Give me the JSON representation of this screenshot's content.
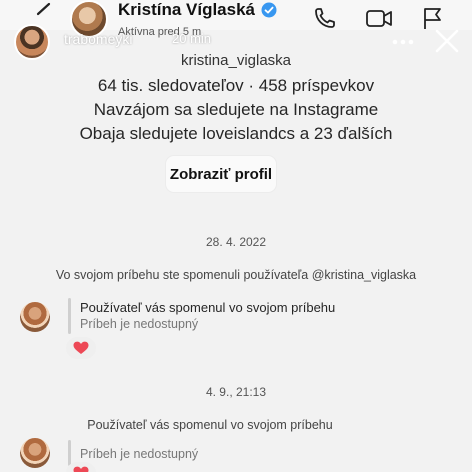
{
  "header": {
    "name": "Kristína Víglaská",
    "status": "Aktívna pred 5 m"
  },
  "story": {
    "username": "trabomeyki",
    "time_ago": "20 min"
  },
  "profile": {
    "handle": "kristina_viglaska",
    "stats": "64 tis. sledovateľov · 458 príspevkov",
    "mutual": "Navzájom sa sledujete na Instagrame",
    "shared": "Obaja sledujete loveislandcs a 23 ďalších",
    "button_label": "Zobraziť profil"
  },
  "thread": {
    "date1": "28. 4. 2022",
    "mention_note": "Vo svojom príbehu ste spomenuli používateľa @kristina_viglaska",
    "message1": {
      "title": "Používateľ vás spomenul vo svojom príbehu",
      "subtitle": "Príbeh je nedostupný",
      "reaction": "heart"
    },
    "date2": "4. 9., 21:13",
    "mention_note2": "Používateľ vás spomenul vo svojom príbehu",
    "message2": {
      "subtitle": "Príbeh je nedostupný",
      "reaction": "heart"
    }
  },
  "colors": {
    "background": "#f2f2f2",
    "verified": "#3897f0",
    "heart": "#ed4956"
  }
}
